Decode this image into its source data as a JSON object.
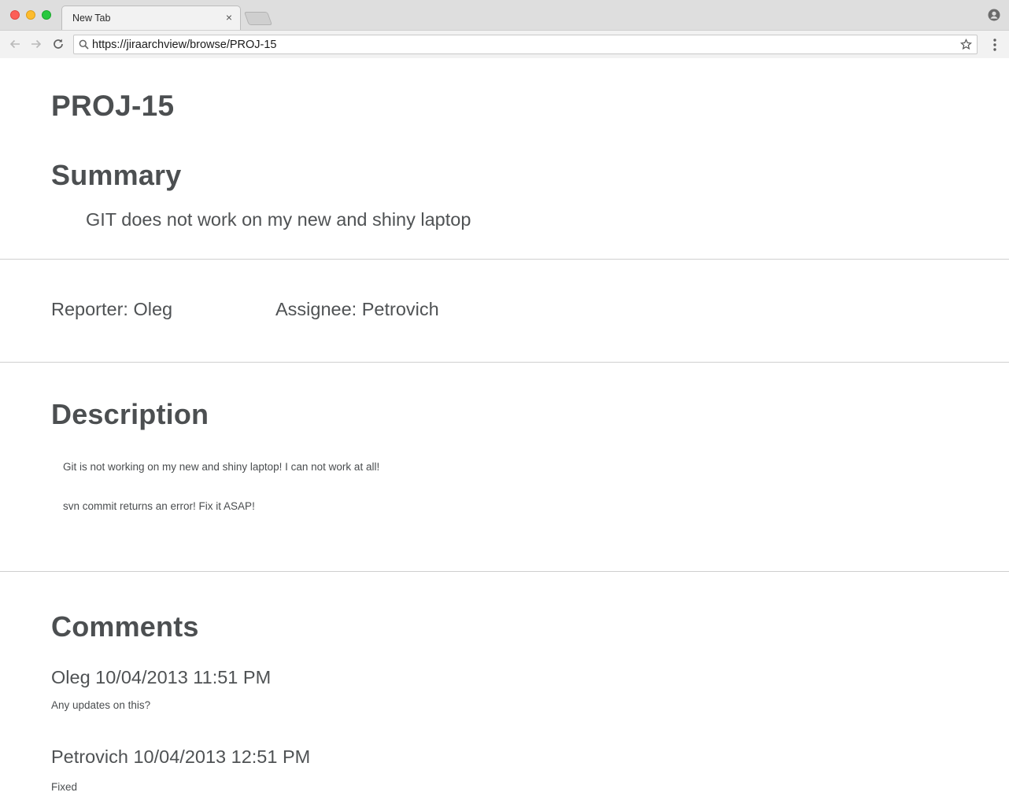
{
  "browser": {
    "tab_title": "New Tab",
    "tab_close": "×",
    "url": "https://jiraarchview/browse/PROJ-15"
  },
  "issue": {
    "key": "PROJ-15",
    "summary_heading": "Summary",
    "summary": "GIT does not work on my new and shiny laptop",
    "reporter": "Reporter: Oleg",
    "assignee": "Assignee: Petrovich",
    "description_heading": "Description",
    "description_lines": [
      "Git is not working on my new and shiny laptop! I can not work at all!",
      "svn commit returns an error! Fix it ASAP!"
    ],
    "comments_heading": "Comments",
    "comments": [
      {
        "header": "Oleg 10/04/2013 11:51 PM",
        "body": "Any updates on this?"
      },
      {
        "header": "Petrovich 10/04/2013 12:51 PM",
        "body": "Fixed"
      }
    ]
  },
  "icons": {
    "back": "arrow-left-icon",
    "forward": "arrow-right-icon",
    "reload": "reload-icon",
    "search": "search-icon",
    "bookmark": "star-icon",
    "menu": "kebab-menu-icon",
    "profile": "profile-icon"
  },
  "colors": {
    "traffic_red": "#fc5f57",
    "traffic_yellow": "#fdbc2e",
    "traffic_green": "#28c83f",
    "text": "#4c4f51",
    "rule": "#cfcfcf"
  }
}
